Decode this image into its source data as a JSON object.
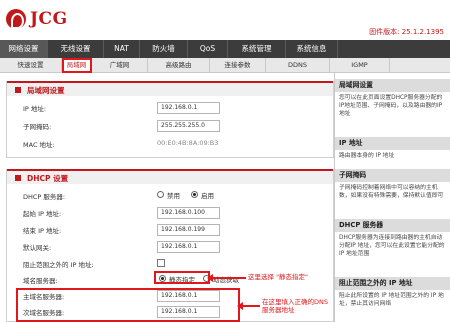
{
  "brand": {
    "name": "JCG"
  },
  "firmware_version": "固件版本: 25.1.2.1395",
  "main_nav": [
    "网络设置",
    "无线设置",
    "NAT",
    "防火墙",
    "QoS",
    "系统管理",
    "系统信息"
  ],
  "sub_nav": [
    "快速设置",
    "局域网",
    "广域网",
    "高级路由",
    "连接参数",
    "DDNS",
    "IGMP"
  ],
  "lan": {
    "title": "局域网设置",
    "ip_label": "IP 地址:",
    "ip_value": "192.168.0.1",
    "mask_label": "子网掩码:",
    "mask_value": "255.255.255.0",
    "mac_label": "MAC 地址:",
    "mac_value": "00:E0:4B:8A:09:B3"
  },
  "dhcp": {
    "title": "DHCP 设置",
    "server_label": "DHCP 服务器:",
    "opt_disable": "禁用",
    "opt_enable": "启用",
    "start_label": "起始 IP 地址:",
    "start_value": "192.168.0.100",
    "end_label": "结束 IP 地址:",
    "end_value": "192.168.0.199",
    "gateway_label": "默认网关:",
    "gateway_value": "192.168.0.1",
    "block_label": "阻止范围之外的 IP 地址:",
    "dns_label": "域名服务器:",
    "dns_static": "静态指定",
    "dns_dynamic": "动态获取",
    "primary_label": "主域名服务器:",
    "primary_value": "192.168.0.1",
    "secondary_label": "次域名服务器:",
    "secondary_value": "192.168.0.1"
  },
  "annotations": {
    "select_static": "这里选择 \"静态指定\"",
    "enter_dns": "在这里填入正确的DNS 服务器地址"
  },
  "help": [
    {
      "title": "局域网设置",
      "body": "您可以在此页面设置DHCP服务器分配的IP地址范围、子网掩码，以及路由器的IP地址"
    },
    {
      "title": "IP 地址",
      "body": "路由器本身的 IP 地址"
    },
    {
      "title": "子网掩码",
      "body": "子网掩码控制着网络中可以容纳的主机数，如果没有特殊需要，保持默认值即可"
    },
    {
      "title": "DHCP 服务器",
      "body": "DHCP服务器为连接到路由器的主机自动分配IP 地址，您可以在此设置它能分配的 IP 地址范围"
    },
    {
      "title": "阻止范围之外的 IP 地址",
      "body": "阻止此所设置的 IP 地址范围之外的 IP 地址，禁止其访问网络"
    }
  ]
}
